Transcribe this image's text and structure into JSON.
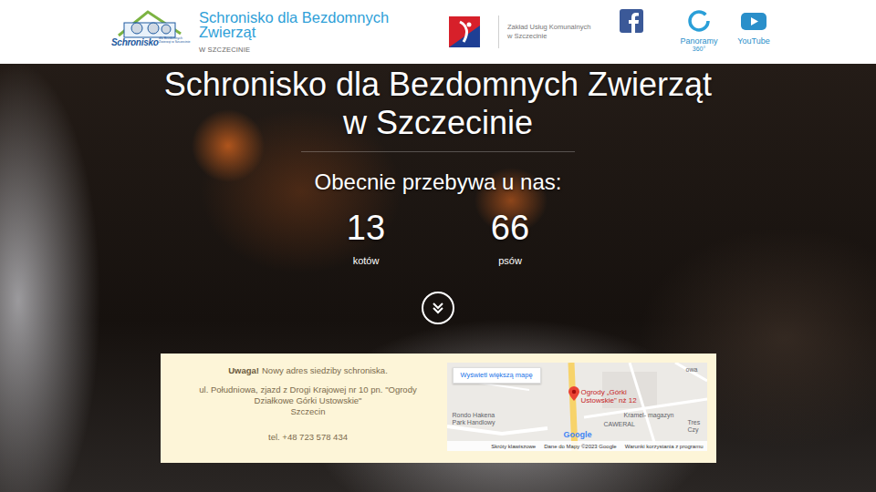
{
  "header": {
    "logo_text": "Schronisko",
    "logo_subtext": "dla Bezdomnych Zwierząt w Szczecinie",
    "title_lines": [
      "Schronisko dla Bezdomnych",
      "Zwierząt"
    ],
    "subtitle": "W SZCZECINIE",
    "partner_lines": [
      "Zakład Usług Komunalnych",
      "w Szczecinie"
    ],
    "panorama": {
      "label": "Panoramy",
      "sub": "360°"
    },
    "youtube": {
      "label": "YouTube"
    }
  },
  "hero": {
    "title_lines": [
      "Schronisko dla Bezdomnych Zwierząt",
      "w Szczecinie"
    ],
    "intro": "Obecnie przebywa u nas:",
    "counts": [
      {
        "value": "13",
        "label": "kotów"
      },
      {
        "value": "66",
        "label": "psów"
      }
    ]
  },
  "notice": {
    "alert": "Uwaga!",
    "message": "Nowy adres siedziby schroniska.",
    "address_lines": [
      "ul. Południowa, zjazd z Drogi Krajowej nr 10 pn. \"Ogrody",
      "Działkowe Górki Ustowskie\"",
      "Szczecin"
    ],
    "phone": "tel. +48 723 578 434"
  },
  "map": {
    "button": "Wyświetl większą mapę",
    "pin_label": "Ogrody „Górki Ustowskie\" nż 12",
    "labels": [
      "Rondo Hakena",
      "Park Handlowy",
      "CAWERAL",
      "Kramel- magazyn",
      "Tres",
      "Czy",
      "owa"
    ],
    "logo": "Google",
    "attribution": [
      "Skróty klawiszowe",
      "Dane do Mapy ©2023 Google",
      "Warunki korzystania z programu"
    ]
  }
}
